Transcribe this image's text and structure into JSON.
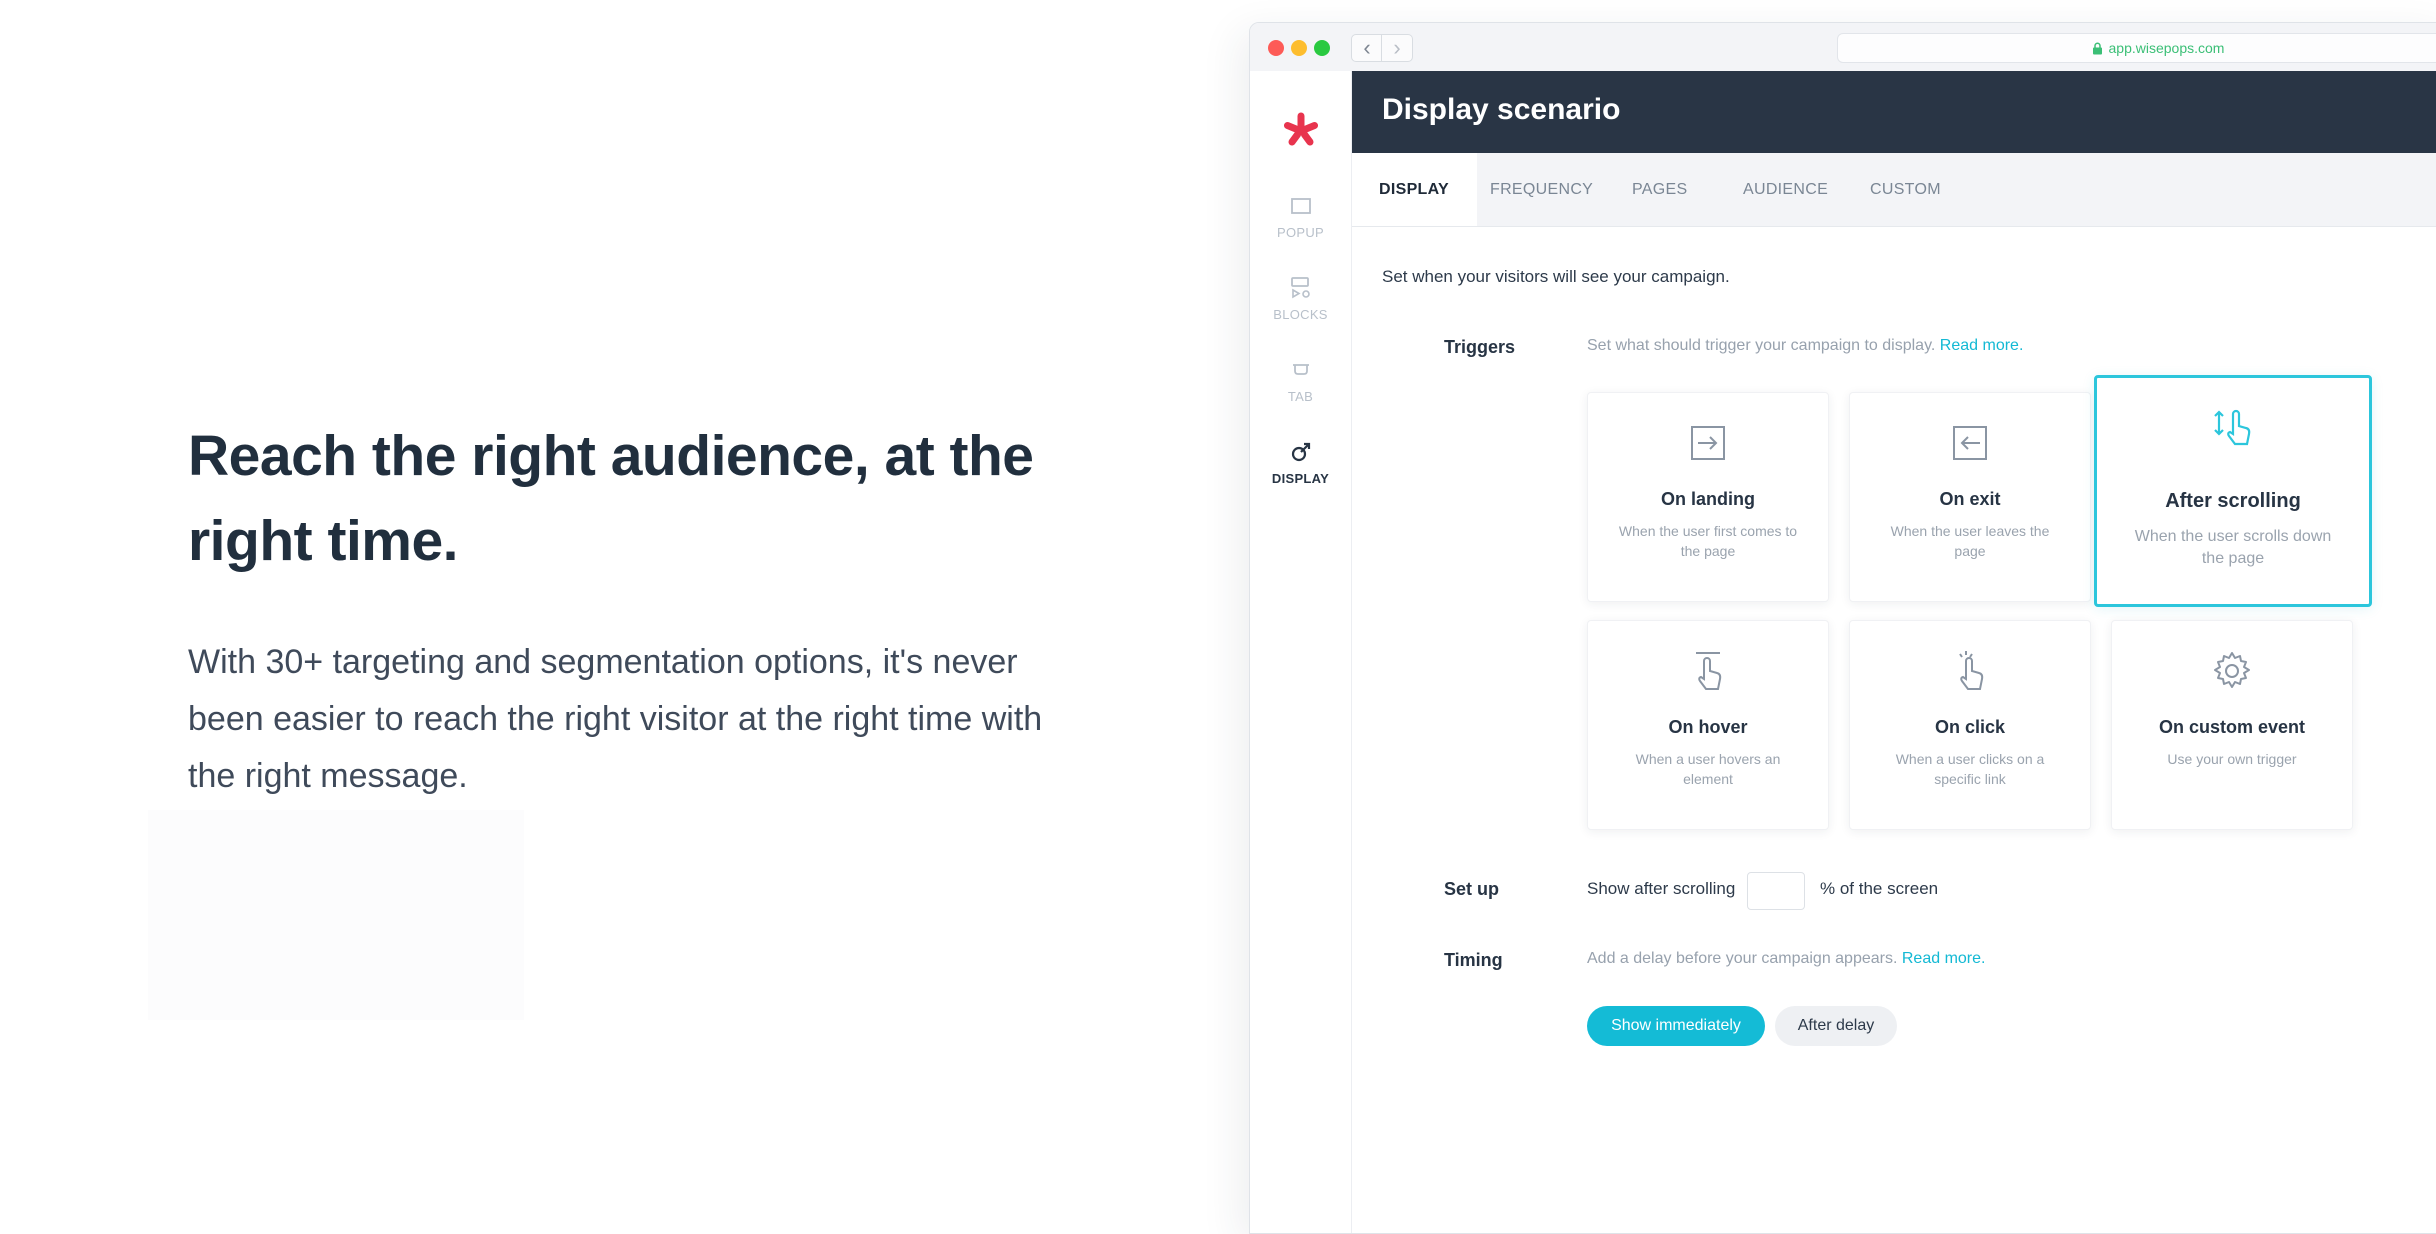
{
  "hero": {
    "title": "Reach the right audience, at the right time.",
    "body": "With 30+ targeting and segmentation options, it's never been easier to reach the right visitor at the right time with the right message."
  },
  "browser": {
    "url": "app.wisepops.com",
    "accent": "#3bbf76"
  },
  "sidebar": {
    "items": [
      {
        "label": "POPUP",
        "icon": "popup-icon"
      },
      {
        "label": "BLOCKS",
        "icon": "blocks-icon"
      },
      {
        "label": "TAB",
        "icon": "tab-icon"
      },
      {
        "label": "DISPLAY",
        "icon": "display-icon",
        "active": true
      }
    ]
  },
  "header": {
    "title": "Display scenario"
  },
  "tabs": [
    {
      "label": "DISPLAY",
      "active": true
    },
    {
      "label": "FREQUENCY"
    },
    {
      "label": "PAGES"
    },
    {
      "label": "AUDIENCE"
    },
    {
      "label": "CUSTOM"
    }
  ],
  "content": {
    "intro": "Set when your visitors will see your campaign.",
    "triggers_label": "Triggers",
    "triggers_hint": "Set what should trigger your campaign to display.",
    "read_more": "Read more.",
    "cards": [
      {
        "title": "On landing",
        "desc": "When the user first comes to the page",
        "icon": "enter-icon"
      },
      {
        "title": "On exit",
        "desc": "When the user leaves the page",
        "icon": "exit-icon"
      },
      {
        "title": "After scrolling",
        "desc": "When the user scrolls down the page",
        "icon": "scroll-hand-icon",
        "selected": true
      },
      {
        "title": "On hover",
        "desc": "When a user hovers an element",
        "icon": "hover-hand-icon"
      },
      {
        "title": "On click",
        "desc": "When a user clicks on a specific link",
        "icon": "click-hand-icon"
      },
      {
        "title": "On custom event",
        "desc": "Use your own trigger",
        "icon": "gear-icon"
      }
    ],
    "setup_label": "Set up",
    "setup_prefix": "Show after scrolling",
    "setup_value": "",
    "setup_suffix": "% of the screen",
    "timing_label": "Timing",
    "timing_hint": "Add a delay before your campaign appears.",
    "show_immediately": "Show immediately",
    "after_delay": "After delay"
  },
  "colors": {
    "brand": "#e8344e",
    "accent": "#14bbd6",
    "header_bg": "#293545"
  }
}
